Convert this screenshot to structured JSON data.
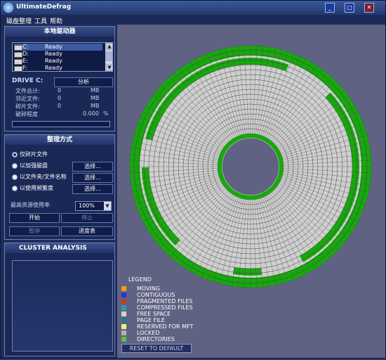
{
  "window": {
    "title": "UltimateDefrag",
    "icon": "app-disk-icon",
    "buttons": {
      "minimize": "minimize-icon",
      "maximize": "maximize-icon",
      "close": "close-icon"
    }
  },
  "menu": [
    "磁盘整理",
    "工具",
    "帮助"
  ],
  "drives_panel": {
    "header": "本地驱动器",
    "drives": [
      {
        "letter": "C:",
        "status": "Ready"
      },
      {
        "letter": "D:",
        "status": "Ready"
      },
      {
        "letter": "E:",
        "status": "Ready"
      },
      {
        "letter": "F:",
        "status": "Ready"
      }
    ],
    "drive_label": "DRIVE C:",
    "analyze_button": "分析",
    "stats": [
      {
        "label": "文件总计:",
        "value": "0",
        "unit": "MB"
      },
      {
        "label": "邻近文件:",
        "value": "0",
        "unit": "MB"
      },
      {
        "label": "碎片文件:",
        "value": "0",
        "unit": "MB"
      },
      {
        "label": "破碎程度",
        "value": "0.000",
        "unit": "%"
      }
    ],
    "progress": 0
  },
  "mode_panel": {
    "header": "整理方式",
    "options": [
      {
        "label": "仅碎片文件",
        "selected": true,
        "button": ""
      },
      {
        "label": "以加强磁盘",
        "selected": false,
        "button": "选择..."
      },
      {
        "label": "以文件夹/文件名称",
        "selected": false,
        "button": "选择..."
      },
      {
        "label": "以使用频繁度",
        "selected": false,
        "button": "选择..."
      }
    ],
    "max_resource_label": "最高资源使用率",
    "max_resource_value": "100%",
    "start_button": "开始",
    "stop_button": "停止",
    "pause_button": "暂停",
    "schedule_button": "进度表"
  },
  "cluster_panel": {
    "header": "CLUSTER ANALYSIS"
  },
  "legend": {
    "title": "LEGEND",
    "items": [
      {
        "label": "MOVING",
        "color": "#f4a000"
      },
      {
        "label": "CONTIGUOUS",
        "color": "#1a3bd6"
      },
      {
        "label": "FRAGMENTED FILES",
        "color": "#c2401f"
      },
      {
        "label": "COMPRESSED FILES",
        "color": "#2d9bb3"
      },
      {
        "label": "FREE SPACE",
        "color": "#d3d3d3"
      },
      {
        "label": "PAGE FILE",
        "color": "#207b83"
      },
      {
        "label": "RESERVED FOR MFT",
        "color": "#f3f07a"
      },
      {
        "label": "LOCKED",
        "color": "#b0b0b0"
      },
      {
        "label": "DIRECTORIES",
        "color": "#5fbf47"
      }
    ],
    "reset_button": "RESET TO DEFAULT"
  },
  "colors": {
    "used_space": "#17a80d",
    "free_space": "#cfcfcf",
    "background": "#5f6283"
  }
}
